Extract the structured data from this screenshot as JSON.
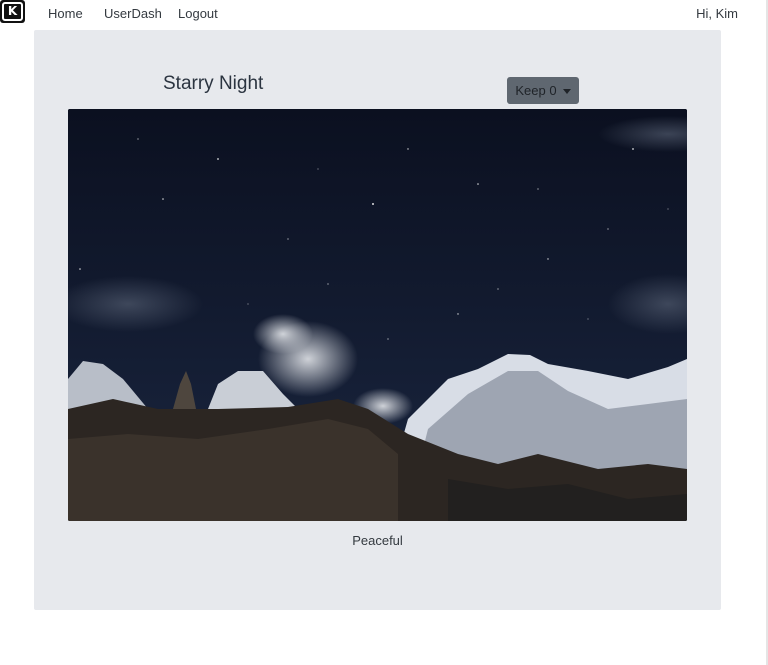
{
  "nav": {
    "logo_letter": "K",
    "links": [
      "Home",
      "UserDash",
      "Logout"
    ],
    "greeting": "Hi, Kim"
  },
  "post": {
    "title": "Starry Night",
    "keep_label": "Keep 0",
    "caption": "Peaceful"
  },
  "colors": {
    "card_bg": "#e7e9ed",
    "button_bg": "#5f6770",
    "sky_top": "#0b1020",
    "sky_bottom": "#1a2640"
  },
  "icons": [
    "caret-down-icon",
    "logo-k-icon"
  ]
}
